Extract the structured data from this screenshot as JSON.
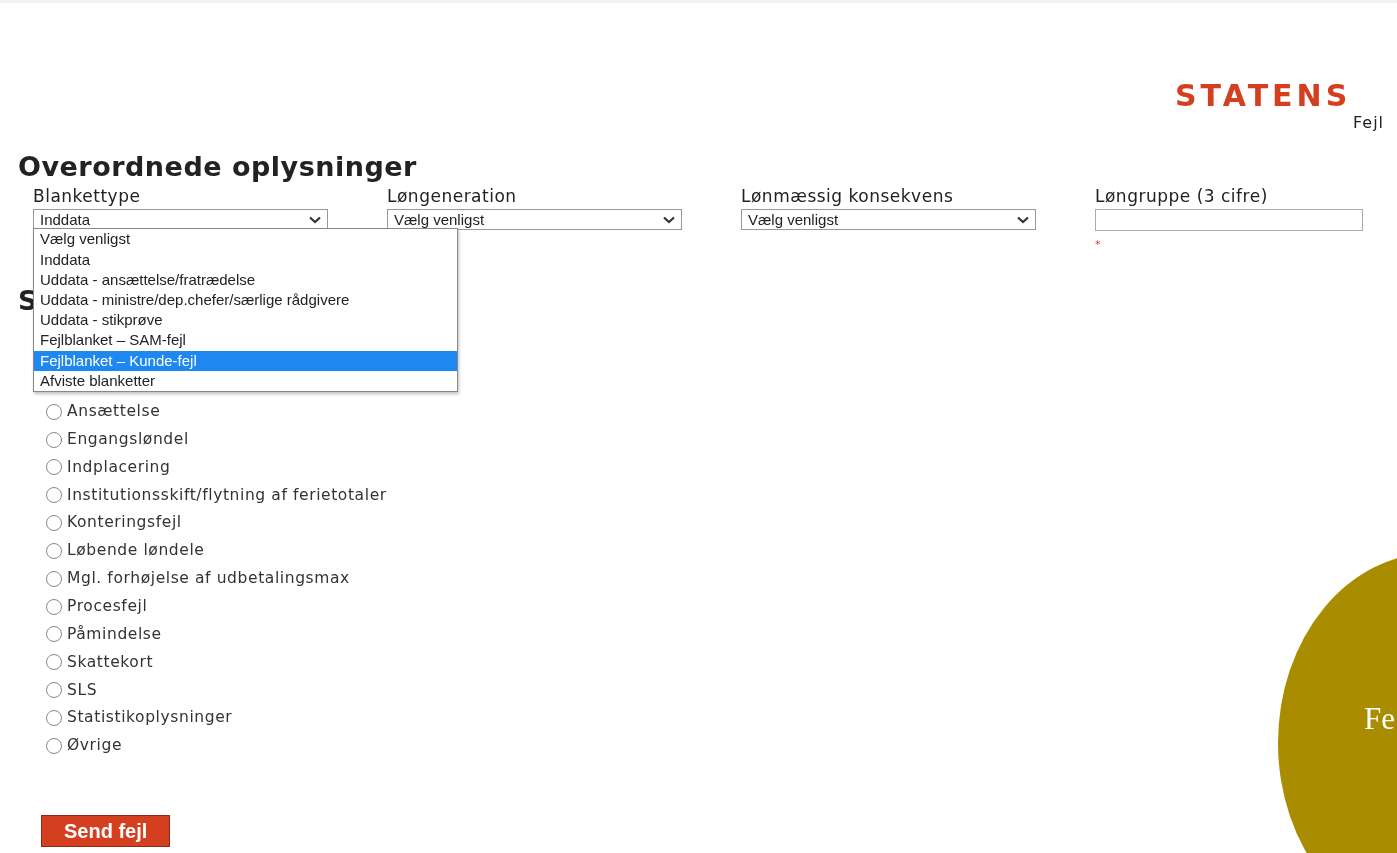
{
  "logo": {
    "title": "STATENS",
    "subtitle": "Fejl"
  },
  "heading": "Overordnede oplysninger",
  "fields": [
    {
      "kind": "select",
      "label": "Blankettype",
      "value": "Inddata",
      "open": true
    },
    {
      "kind": "select",
      "label": "Løngeneration",
      "value": "Vælg venligst",
      "open": false
    },
    {
      "kind": "select",
      "label": "Lønmæssig konsekvens",
      "value": "Vælg venligst",
      "open": false
    },
    {
      "kind": "text",
      "label": "Løngruppe (3 cifre)",
      "required_mark": "*"
    }
  ],
  "dropdown_options": [
    {
      "label": "Vælg venligst",
      "selected": false
    },
    {
      "label": "Inddata",
      "selected": false
    },
    {
      "label": "Uddata - ansættelse/fratrædelse",
      "selected": false
    },
    {
      "label": "Uddata - ministre/dep.chefer/særlige rådgivere",
      "selected": false
    },
    {
      "label": "Uddata - stikprøve",
      "selected": false
    },
    {
      "label": "Fejlblanket – SAM-fejl",
      "selected": false
    },
    {
      "label": "Fejlblanket – Kunde-fejl",
      "selected": true
    },
    {
      "label": "Afviste blanketter",
      "selected": false
    }
  ],
  "second_heading": "S",
  "categories": [
    {
      "label": "Ansættelse",
      "checked": false
    },
    {
      "label": "Engangsløndel",
      "checked": false
    },
    {
      "label": "Indplacering",
      "checked": false
    },
    {
      "label": "Institutionsskift/flytning af ferietotaler",
      "checked": false
    },
    {
      "label": "Konteringsfejl",
      "checked": false
    },
    {
      "label": "Løbende løndele",
      "checked": false
    },
    {
      "label": "Mgl. forhøjelse af udbetalingsmax",
      "checked": false
    },
    {
      "label": "Procesfejl",
      "checked": false
    },
    {
      "label": "Påmindelse",
      "checked": false
    },
    {
      "label": "Skattekort",
      "checked": false
    },
    {
      "label": "SLS",
      "checked": false
    },
    {
      "label": "Statistikoplysninger",
      "checked": false
    },
    {
      "label": "Øvrige",
      "checked": false
    }
  ],
  "submit_button": "Send fejl",
  "badge": {
    "text": "Fe"
  }
}
